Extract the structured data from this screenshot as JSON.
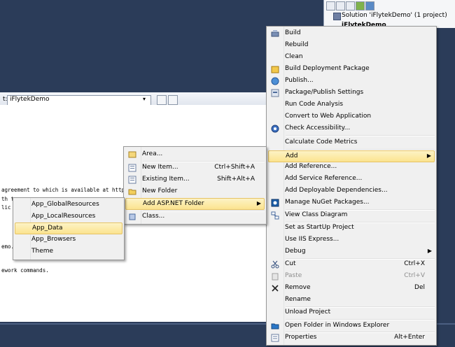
{
  "solution_explorer": {
    "solution_label": "Solution 'iFlytekDemo' (1 project)",
    "project_label": "iFlytekDemo"
  },
  "editor": {
    "combo_prefix": "t:",
    "combo_value": "iFlytekDemo",
    "code_lines": [
      "agreement to which is available at http",
      "th t",
      " lic",
      "emo.",
      "ework commands."
    ]
  },
  "context_menu": {
    "items": [
      {
        "label": "Build",
        "shortcut": "",
        "icon": "build-icon"
      },
      {
        "label": "Rebuild",
        "shortcut": "",
        "icon": ""
      },
      {
        "label": "Clean",
        "shortcut": "",
        "icon": ""
      },
      {
        "label": "Build Deployment Package",
        "shortcut": "",
        "icon": "package-icon"
      },
      {
        "label": "Publish...",
        "shortcut": "",
        "icon": "publish-icon"
      },
      {
        "label": "Package/Publish Settings",
        "shortcut": "",
        "icon": "settings-icon"
      },
      {
        "label": "Run Code Analysis",
        "shortcut": "",
        "icon": ""
      },
      {
        "label": "Convert to Web Application",
        "shortcut": "",
        "icon": ""
      },
      {
        "label": "Check Accessibility...",
        "shortcut": "",
        "icon": "accessibility-icon"
      },
      {
        "label": "Calculate Code Metrics",
        "shortcut": "",
        "icon": ""
      },
      {
        "label": "Add",
        "shortcut": "",
        "icon": ""
      },
      {
        "label": "Add Reference...",
        "shortcut": "",
        "icon": ""
      },
      {
        "label": "Add Service Reference...",
        "shortcut": "",
        "icon": ""
      },
      {
        "label": "Add Deployable Dependencies...",
        "shortcut": "",
        "icon": ""
      },
      {
        "label": "Manage NuGet Packages...",
        "shortcut": "",
        "icon": "nuget-icon"
      },
      {
        "label": "View Class Diagram",
        "shortcut": "",
        "icon": "class-diagram-icon"
      },
      {
        "label": "Set as StartUp Project",
        "shortcut": "",
        "icon": ""
      },
      {
        "label": "Use IIS Express...",
        "shortcut": "",
        "icon": ""
      },
      {
        "label": "Debug",
        "shortcut": "",
        "icon": ""
      },
      {
        "label": "Cut",
        "shortcut": "Ctrl+X",
        "icon": "cut-icon"
      },
      {
        "label": "Paste",
        "shortcut": "Ctrl+V",
        "icon": "paste-icon"
      },
      {
        "label": "Remove",
        "shortcut": "Del",
        "icon": "remove-icon"
      },
      {
        "label": "Rename",
        "shortcut": "",
        "icon": ""
      },
      {
        "label": "Unload Project",
        "shortcut": "",
        "icon": ""
      },
      {
        "label": "Open Folder in Windows Explorer",
        "shortcut": "",
        "icon": "folder-icon"
      },
      {
        "label": "Properties",
        "shortcut": "Alt+Enter",
        "icon": "properties-icon"
      }
    ]
  },
  "add_submenu": {
    "items": [
      {
        "label": "Area...",
        "shortcut": ""
      },
      {
        "label": "New Item...",
        "shortcut": "Ctrl+Shift+A"
      },
      {
        "label": "Existing Item...",
        "shortcut": "Shift+Alt+A"
      },
      {
        "label": "New Folder",
        "shortcut": ""
      },
      {
        "label": "Add ASP.NET Folder",
        "shortcut": ""
      },
      {
        "label": "Class...",
        "shortcut": ""
      }
    ]
  },
  "aspnet_folder_submenu": {
    "items": [
      {
        "label": "App_GlobalResources"
      },
      {
        "label": "App_LocalResources"
      },
      {
        "label": "App_Data"
      },
      {
        "label": "App_Browsers"
      },
      {
        "label": "Theme"
      }
    ]
  },
  "colors": {
    "ide_background": "#2b3c59",
    "menu_background": "#f0f0f0",
    "highlight": "#fbe38f"
  }
}
